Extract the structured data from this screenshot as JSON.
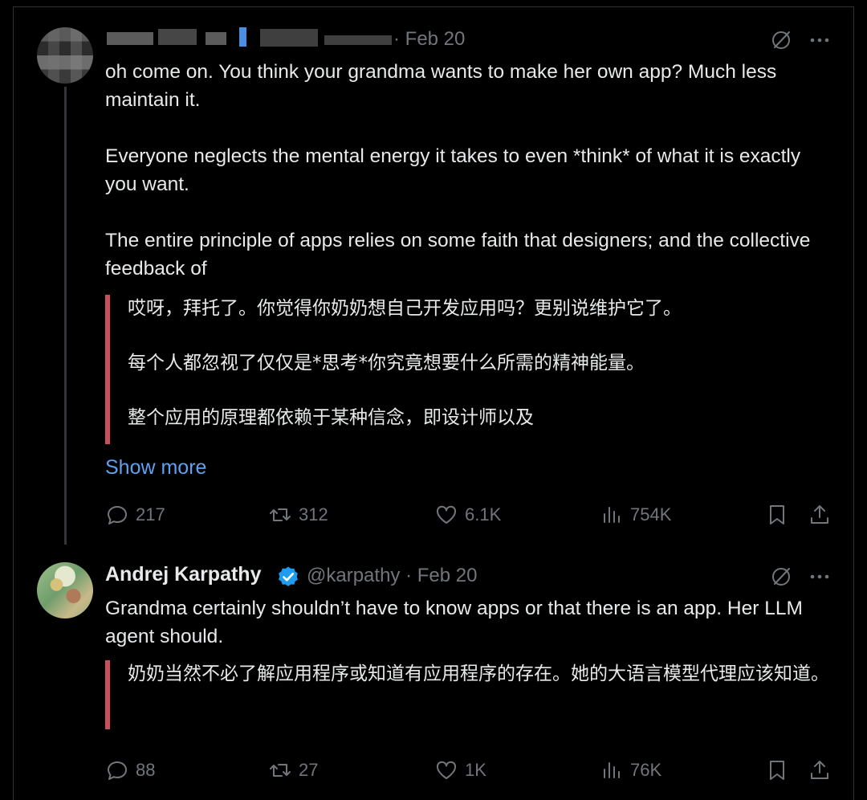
{
  "tweet1": {
    "date_meta": "· Feb 20",
    "paragraphs": [
      "oh come on. You think your grandma wants to make her own app? Much less maintain it.",
      "Everyone neglects the mental energy it takes to even *think* of what it is exactly you want.",
      "The entire principle of apps relies on some faith that designers; and the collective feedback of"
    ],
    "translation": [
      "哎呀，拜托了。你觉得你奶奶想自己开发应用吗？更别说维护它了。",
      "每个人都忽视了仅仅是*思考*你究竟想要什么所需的精神能量。",
      "整个应用的原理都依赖于某种信念，即设计师以及"
    ],
    "show_more": "Show more",
    "stats": {
      "replies": "217",
      "reposts": "312",
      "likes": "6.1K",
      "views": "754K"
    }
  },
  "tweet2": {
    "name": "Andrej Karpathy",
    "handle_meta": "@karpathy · Feb 20",
    "text": "Grandma certainly shouldn’t have to know apps or that there is an app. Her LLM agent should.",
    "translation": "奶奶当然不必了解应用程序或知道有应用程序的存在。她的大语言模型代理应该知道。",
    "stats": {
      "replies": "88",
      "reposts": "27",
      "likes": "1K",
      "views": "76K"
    }
  },
  "icons": {
    "grok": "grok-slash-circle-icon",
    "more": "more-dots-icon",
    "reply": "reply-bubble-icon",
    "repost": "repost-arrows-icon",
    "like": "heart-icon",
    "views": "views-bar-chart-icon",
    "bookmark": "bookmark-icon",
    "share": "share-upload-icon"
  },
  "colors": {
    "background": "#000000",
    "text": "#e7e9ea",
    "muted": "#71767b",
    "link": "#5ea2ef",
    "translation_bar": "#c94f5a",
    "verified": "#1d9bf0"
  }
}
